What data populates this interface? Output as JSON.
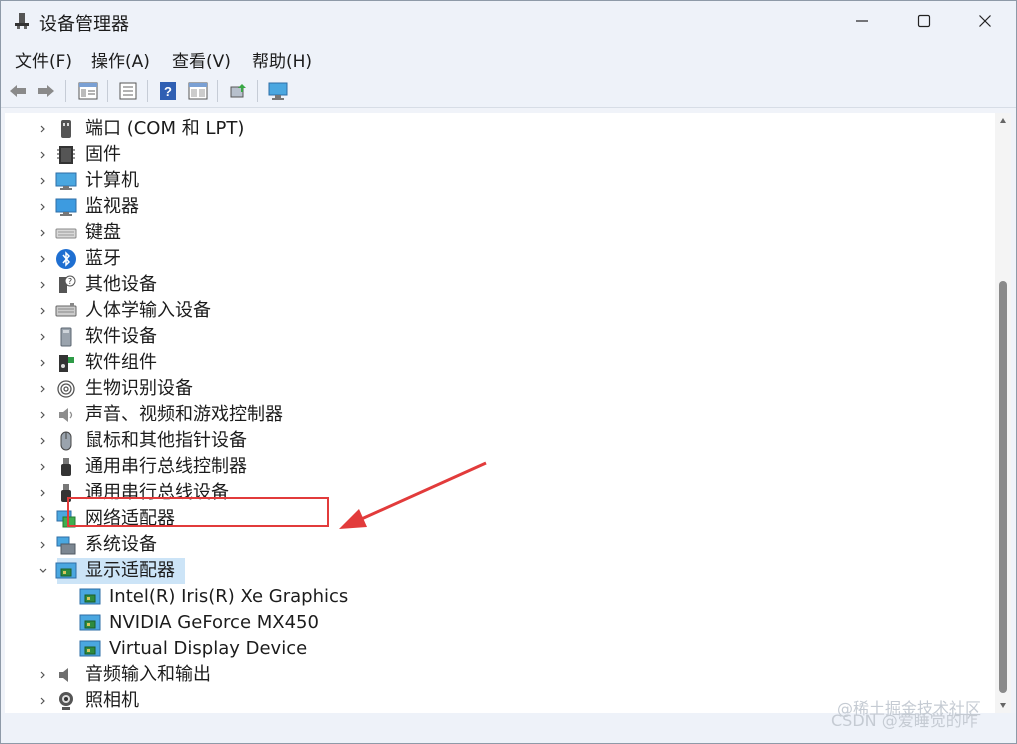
{
  "window": {
    "title": "设备管理器",
    "minimize_icon": "minimize-icon",
    "maximize_icon": "maximize-icon",
    "close_icon": "close-icon"
  },
  "menu": {
    "file": "文件(F)",
    "action": "操作(A)",
    "view": "查看(V)",
    "help": "帮助(H)"
  },
  "toolbar": {
    "buttons": [
      "back-arrow-icon",
      "forward-arrow-icon",
      "properties-icon",
      "list-icon",
      "help-icon",
      "view-icon",
      "update-driver-icon",
      "scan-hardware-icon"
    ]
  },
  "tree": {
    "items": [
      {
        "label": "端口 (COM 和 LPT)",
        "icon": "port-icon",
        "expanded": false
      },
      {
        "label": "固件",
        "icon": "firmware-icon",
        "expanded": false
      },
      {
        "label": "计算机",
        "icon": "computer-icon",
        "expanded": false
      },
      {
        "label": "监视器",
        "icon": "monitor-icon",
        "expanded": false
      },
      {
        "label": "键盘",
        "icon": "keyboard-icon",
        "expanded": false
      },
      {
        "label": "蓝牙",
        "icon": "bluetooth-icon",
        "expanded": false
      },
      {
        "label": "其他设备",
        "icon": "other-devices-icon",
        "expanded": false
      },
      {
        "label": "人体学输入设备",
        "icon": "hid-icon",
        "expanded": false
      },
      {
        "label": "软件设备",
        "icon": "software-device-icon",
        "expanded": false
      },
      {
        "label": "软件组件",
        "icon": "software-component-icon",
        "expanded": false
      },
      {
        "label": "生物识别设备",
        "icon": "biometric-icon",
        "expanded": false
      },
      {
        "label": "声音、视频和游戏控制器",
        "icon": "speaker-icon",
        "expanded": false
      },
      {
        "label": "鼠标和其他指针设备",
        "icon": "mouse-icon",
        "expanded": false
      },
      {
        "label": "通用串行总线控制器",
        "icon": "usb-icon",
        "expanded": false
      },
      {
        "label": "通用串行总线设备",
        "icon": "usb-icon",
        "expanded": false
      },
      {
        "label": "网络适配器",
        "icon": "network-icon",
        "expanded": false
      },
      {
        "label": "系统设备",
        "icon": "system-icon",
        "expanded": false
      },
      {
        "label": "显示适配器",
        "icon": "display-adapter-icon",
        "expanded": true
      }
    ],
    "display_adapter_children": [
      {
        "label": "Intel(R) Iris(R) Xe Graphics",
        "icon": "display-adapter-icon"
      },
      {
        "label": "NVIDIA GeForce MX450",
        "icon": "display-adapter-icon"
      },
      {
        "label": "Virtual Display Device",
        "icon": "display-adapter-icon"
      }
    ],
    "items_after": [
      {
        "label": "音频输入和输出",
        "icon": "audio-icon",
        "expanded": false
      },
      {
        "label": "照相机",
        "icon": "camera-icon",
        "expanded": false
      }
    ]
  },
  "annotation": {
    "highlight_color": "#e23b3b",
    "highlighted_item": "NVIDIA GeForce MX450"
  },
  "watermark": "@稀土掘金技术社区\nCSDN @爱睡觉的咋",
  "watermark_line1": "@稀土掘金技术社区",
  "watermark_line2": "CSDN @爱睡觉的咋"
}
